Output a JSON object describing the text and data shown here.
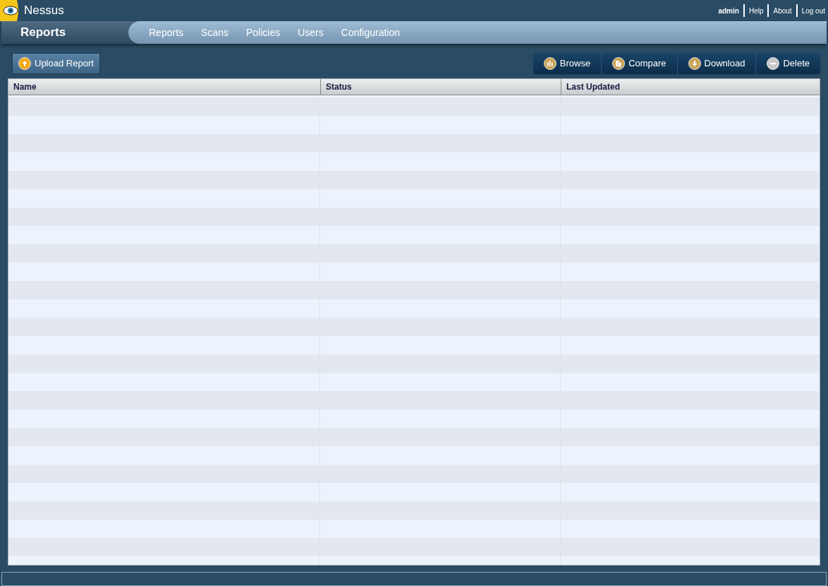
{
  "brand": {
    "name": "Nessus"
  },
  "user_menu": [
    {
      "label": "admin",
      "kind": "user"
    },
    {
      "label": "Help",
      "kind": "link"
    },
    {
      "label": "About",
      "kind": "link"
    },
    {
      "label": "Log out",
      "kind": "link"
    }
  ],
  "page_title": "Reports",
  "nav": [
    "Reports",
    "Scans",
    "Policies",
    "Users",
    "Configuration"
  ],
  "upload_button": {
    "label": "Upload Report"
  },
  "actions": [
    {
      "label": "Browse",
      "kind": "browse"
    },
    {
      "label": "Compare",
      "kind": "compare"
    },
    {
      "label": "Download",
      "kind": "download"
    },
    {
      "label": "Delete",
      "kind": "delete"
    }
  ],
  "table": {
    "columns": [
      "Name",
      "Status",
      "Last Updated"
    ]
  }
}
